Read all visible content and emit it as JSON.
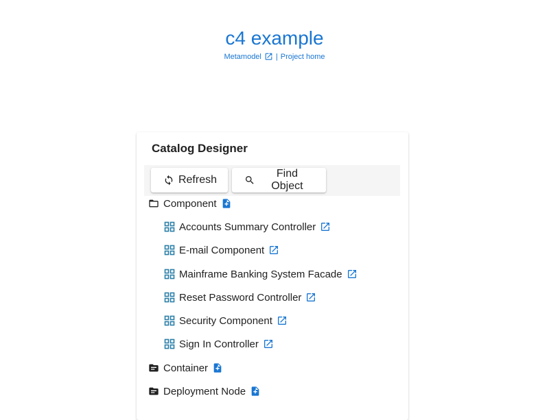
{
  "header": {
    "title": "c4 example",
    "metamodel_link": "Metamodel",
    "separator": "|",
    "project_home_link": "Project home"
  },
  "catalog": {
    "title": "Catalog Designer",
    "toolbar": {
      "refresh_label": "Refresh",
      "find_label": "Find Object"
    },
    "folders": [
      {
        "label": "Component",
        "icon": "folder-open-outline-icon",
        "items": [
          "Accounts Summary Controller",
          "E-mail Component",
          "Mainframe Banking System Facade",
          "Reset Password Controller",
          "Security Component",
          "Sign In Controller"
        ]
      },
      {
        "label": "Container",
        "icon": "folder-filled-icon",
        "items": []
      },
      {
        "label": "Deployment Node",
        "icon": "folder-filled-icon",
        "items": []
      }
    ]
  },
  "colors": {
    "accent": "#1976d2",
    "icon_teal": "#2b7fa8",
    "toolbar_bg": "#f5f5f5"
  }
}
